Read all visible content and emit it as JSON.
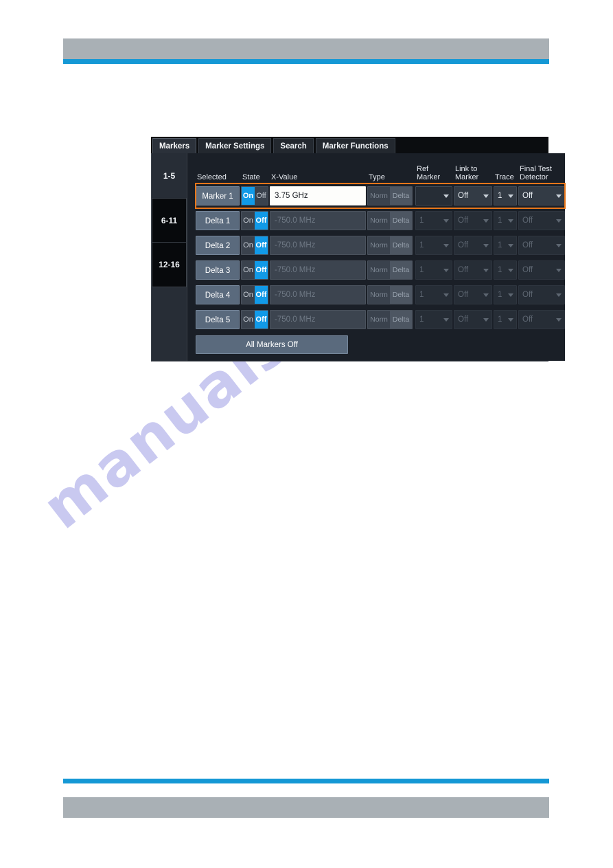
{
  "document": {
    "header_bar_color": "#a9b0b5",
    "accent_rule_color": "#1598d5",
    "watermark_text": "manualshive.com"
  },
  "dialog": {
    "tabs": [
      {
        "label": "Markers",
        "active": true
      },
      {
        "label": "Marker Settings",
        "active": false
      },
      {
        "label": "Search",
        "active": false
      },
      {
        "label": "Marker Functions",
        "active": false
      }
    ],
    "range_selector": [
      {
        "label": "1-5",
        "active": true
      },
      {
        "label": "6-11",
        "active": false
      },
      {
        "label": "12-16",
        "active": false
      }
    ],
    "columns": {
      "selected": "Selected",
      "state": "State",
      "x_value": "X-Value",
      "type": "Type",
      "ref_marker": "Ref\nMarker",
      "link_to_marker": "Link to\nMarker",
      "trace": "Trace",
      "final_test_detector": "Final Test\nDetector"
    },
    "state_toggle": {
      "on_label": "On",
      "off_label": "Off"
    },
    "type_toggle": {
      "norm_label": "Norm",
      "delta_label": "Delta"
    },
    "rows": [
      {
        "selected_label": "Marker 1",
        "state": "On",
        "x_value": "3.75 GHz",
        "x_value_editing": true,
        "type_highlight": "Delta",
        "ref_marker": "",
        "link_to_marker": "Off",
        "trace": "1",
        "final_test_detector": "Off",
        "row_selected": true,
        "dimmed": false
      },
      {
        "selected_label": "Delta 1",
        "state": "Off",
        "x_value": "-750.0 MHz",
        "x_value_editing": false,
        "type_highlight": "Delta",
        "ref_marker": "1",
        "link_to_marker": "Off",
        "trace": "1",
        "final_test_detector": "Off",
        "row_selected": false,
        "dimmed": true
      },
      {
        "selected_label": "Delta 2",
        "state": "Off",
        "x_value": "-750.0 MHz",
        "x_value_editing": false,
        "type_highlight": "Delta",
        "ref_marker": "1",
        "link_to_marker": "Off",
        "trace": "1",
        "final_test_detector": "Off",
        "row_selected": false,
        "dimmed": true
      },
      {
        "selected_label": "Delta 3",
        "state": "Off",
        "x_value": "-750.0 MHz",
        "x_value_editing": false,
        "type_highlight": "Delta",
        "ref_marker": "1",
        "link_to_marker": "Off",
        "trace": "1",
        "final_test_detector": "Off",
        "row_selected": false,
        "dimmed": true
      },
      {
        "selected_label": "Delta 4",
        "state": "Off",
        "x_value": "-750.0 MHz",
        "x_value_editing": false,
        "type_highlight": "Delta",
        "ref_marker": "1",
        "link_to_marker": "Off",
        "trace": "1",
        "final_test_detector": "Off",
        "row_selected": false,
        "dimmed": true
      },
      {
        "selected_label": "Delta 5",
        "state": "Off",
        "x_value": "-750.0 MHz",
        "x_value_editing": false,
        "type_highlight": "Delta",
        "ref_marker": "1",
        "link_to_marker": "Off",
        "trace": "1",
        "final_test_detector": "Off",
        "row_selected": false,
        "dimmed": true
      }
    ],
    "all_markers_off_label": "All Markers Off",
    "accent_selection_color": "#e8761a",
    "toggle_active_color": "#119ae8"
  }
}
